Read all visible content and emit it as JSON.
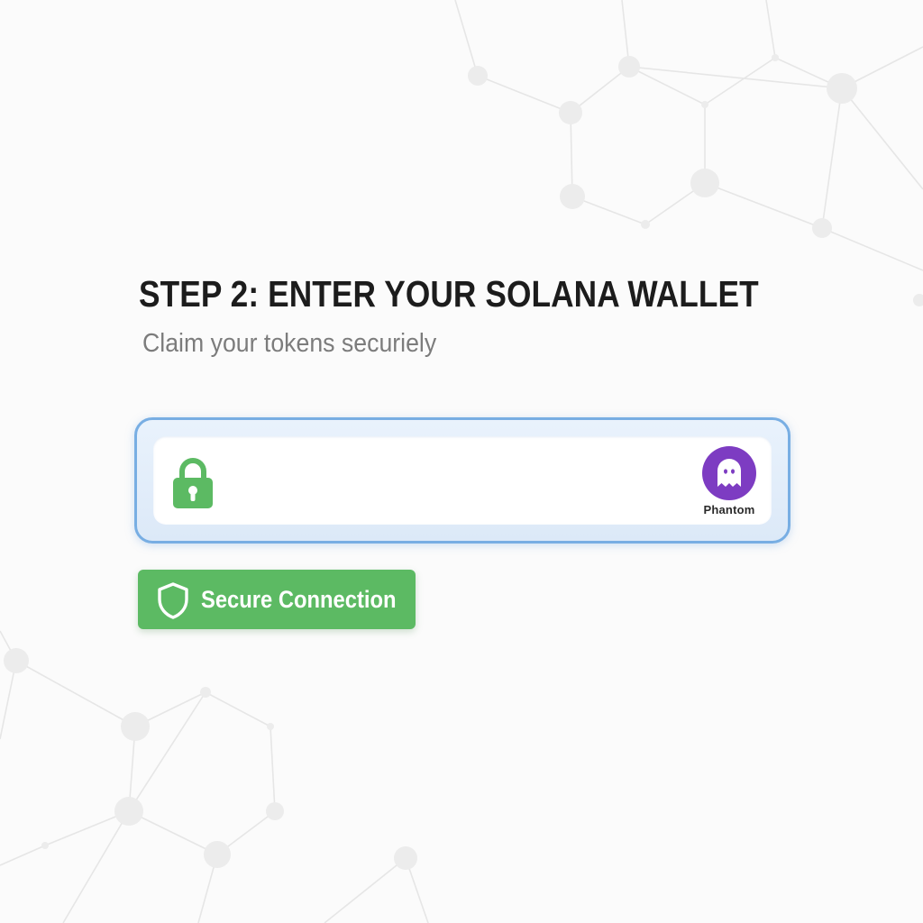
{
  "page": {
    "title": "STEP 2: ENTER YOUR SOLANA WALLET",
    "subtitle": "Claim your tokens securiely"
  },
  "wallet_field": {
    "value": "",
    "lock_icon": "lock-icon",
    "wallet_badge": {
      "icon": "phantom-ghost-icon",
      "label": "Phantom"
    }
  },
  "secure_badge": {
    "icon": "shield-icon",
    "label": "Secure Connection"
  },
  "colors": {
    "field_border": "#78aee3",
    "lock_green": "#5cba63",
    "phantom_purple": "#7d3cc2",
    "badge_green": "#5cba63",
    "title_text": "#1c1c1c",
    "subtitle_text": "#7c7c7c"
  }
}
